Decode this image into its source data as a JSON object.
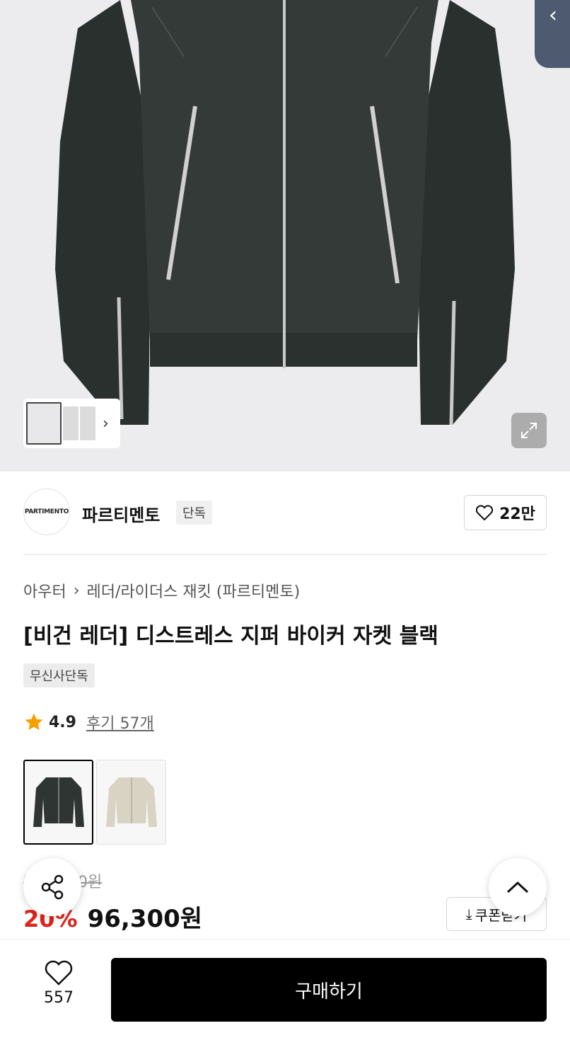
{
  "product_image": {
    "gallery_icon": "chevron-right-icon",
    "expand_icon": "expand-icon"
  },
  "brand": {
    "logo_text": "PARTIMENTO",
    "name": "파르티멘토",
    "tag": "단독",
    "likes": "22만"
  },
  "breadcrumb": {
    "category": "아우터",
    "subcategory": "레더/라이더스 재킷 (파르티멘토)"
  },
  "product": {
    "title": "[비건 레더] 디스트레스 지퍼 바이커 자켓 블랙",
    "badge": "무신사단독",
    "rating": "4.9",
    "reviews": "후기 57개",
    "original_price": "120,000원",
    "discount": "20%",
    "sale_price": "96,300원",
    "coupon": "쿠폰받기"
  },
  "colors": [
    "black",
    "beige"
  ],
  "bottom_bar": {
    "wish_count": "557",
    "buy_label": "구매하기"
  },
  "theme": {
    "accent": "#e0221b",
    "buy_button": "#000000"
  }
}
